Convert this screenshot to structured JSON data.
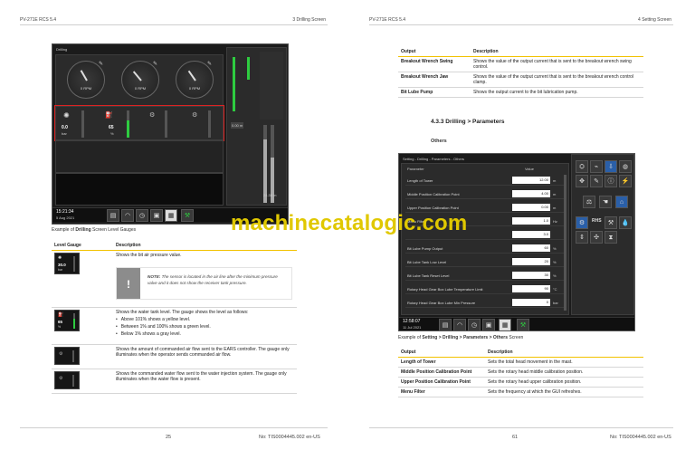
{
  "left_page": {
    "header_left": "PV-271E RCS 5.4",
    "header_right": "3 Drilling Screen",
    "footer_page": "25",
    "footer_doc": "No: TIS0004445.002 en-US",
    "screen": {
      "title": "Drilling",
      "gauges": [
        {
          "value": "0",
          "unit": "RPM"
        },
        {
          "value": "0",
          "unit": "RPM"
        },
        {
          "value": "0",
          "unit": "RPM"
        }
      ],
      "level_values": [
        {
          "value": "0.0",
          "unit": "bar"
        },
        {
          "value": "65",
          "unit": "%"
        }
      ],
      "clock": "15:21:34",
      "date": "5 Aug 2021",
      "depth_right": "0.00 m",
      "depth_bottom": "24.38 m"
    },
    "caption_prefix": "Example of ",
    "caption_bold": "Drilling",
    "caption_suffix": " Screen Level Gauges",
    "table": {
      "col1": "Level Gauge",
      "col2": "Description",
      "rows": [
        {
          "thumb_value": "30.0",
          "thumb_unit": "bar",
          "desc": "Shows the bit air pressure value."
        },
        {
          "thumb_value": "65",
          "thumb_unit": "%",
          "desc": "Shows the water tank level. The gauge shows the level as follows:",
          "bullets": [
            "Above 101% shows a yellow level.",
            "Between 1% and 100% shows a green level.",
            "Below 1% shows a gray level."
          ]
        },
        {
          "thumb_value": "",
          "thumb_unit": "",
          "desc": "Shows the amount of commanded air flow sent to the EARS controller. The gauge only illuminates when the operator sends commanded air flow."
        },
        {
          "thumb_value": "",
          "thumb_unit": "",
          "desc": "Shows the commanded water flow sent to the water injection system. The gauge only illuminates when the water flow is present."
        }
      ],
      "note_label": "NOTE:",
      "note_text": " The sensor is located in the air line after the minimum pressure valve and it does not show the receiver tank pressure."
    }
  },
  "right_page": {
    "header_left": "PV-271E RCS 5.4",
    "header_right": "4 Setting Screen",
    "footer_page": "61",
    "footer_doc": "No: TIS0004445.002 en-US",
    "top_table": {
      "col1": "Output",
      "col2": "Description",
      "rows": [
        {
          "name": "Breakout Wrench Swing",
          "desc": "Shows the value of the output current that is sent to the breakout wrench swing control."
        },
        {
          "name": "Breakout Wrench Jaw",
          "desc": "Shows the value of the output current that is sent to the breakout wrench control clamp."
        },
        {
          "name": "Bit Lube Pump",
          "desc": "Shows the output current to the bit lubrication pump."
        }
      ]
    },
    "section_heading": "4.3.3 Drilling > Parameters",
    "subsection": "Others",
    "screen": {
      "breadcrumb": "Setting - Drilling - Parameters - Others",
      "col_param": "Parameter",
      "col_value": "Value",
      "params": [
        {
          "label": "Length of Tower",
          "value": "12.00",
          "unit": "m"
        },
        {
          "label": "Middle Position Calibration Point",
          "value": "4.00",
          "unit": "m"
        },
        {
          "label": "Upper Position Calibration Point",
          "value": "0.00",
          "unit": "m"
        },
        {
          "label": "Menu Filter",
          "value": "1.0",
          "unit": "Hz"
        },
        {
          "label": "",
          "value": "3.0",
          "unit": ""
        },
        {
          "label": "Bit Lube Pump Output",
          "value": "60",
          "unit": "%"
        },
        {
          "label": "Bit Lube Tank Low Level",
          "value": "20",
          "unit": "%"
        },
        {
          "label": "Bit Lube Tank Reset Level",
          "value": "30",
          "unit": "%"
        },
        {
          "label": "Rotary Head Gear Box Lube Temperature Limit",
          "value": "90",
          "unit": "°C"
        },
        {
          "label": "Rotary Head Gear Box Lube Min Pressure",
          "value": "0",
          "unit": "bar"
        }
      ],
      "clock": "12:58:07",
      "date": "11 Jul 2021",
      "side_label": "RHS"
    },
    "caption_prefix": "Example of ",
    "caption_bold": "Setting > Drilling > Parameters > Others",
    "caption_suffix": " Screen",
    "bottom_table": {
      "col1": "Output",
      "col2": "Description",
      "rows": [
        {
          "name": "Length of Tower",
          "desc": "Sets the total head movement in the mast."
        },
        {
          "name": "Middle Position Calibration Point",
          "desc": "Sets the rotary head middle calibration position."
        },
        {
          "name": "Upper Position Calibration Point",
          "desc": "Sets the rotary head upper calibration position."
        },
        {
          "name": "Menu Filter",
          "desc": "Sets the frequency at which the GUI refreshes."
        }
      ]
    }
  },
  "watermark": "machinecatalogic.com",
  "colors": {
    "accent_yellow": "#f2c200",
    "watermark": "#e0c800",
    "highlight_red": "#dd2222",
    "level_green": "#2ecc40"
  }
}
